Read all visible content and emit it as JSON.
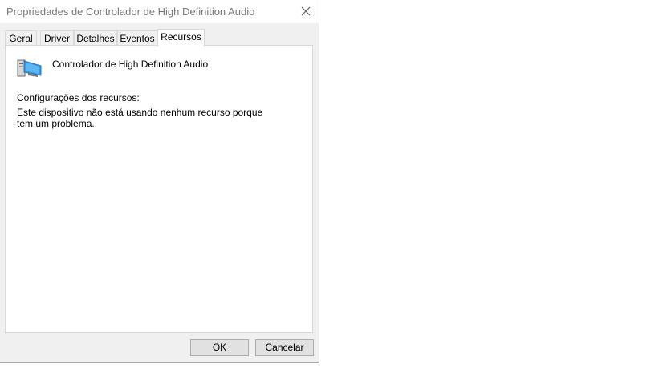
{
  "window": {
    "title": "Propriedades de Controlador de High Definition Audio"
  },
  "tabs": [
    {
      "label": "Geral"
    },
    {
      "label": "Driver"
    },
    {
      "label": "Detalhes"
    },
    {
      "label": "Eventos"
    },
    {
      "label": "Recursos",
      "active": true
    }
  ],
  "panel": {
    "device_name": "Controlador de High Definition Audio",
    "device_icon": "computer-monitor-icon",
    "resources_label": "Configurações dos recursos:",
    "resources_message": "Este dispositivo não está usando nenhum recurso porque tem um problema."
  },
  "buttons": {
    "ok": "OK",
    "cancel": "Cancelar"
  },
  "colors": {
    "icon_blue": "#3a9be6",
    "dialog_bg": "#f0f0f0",
    "title_text": "#7a7a7a"
  }
}
